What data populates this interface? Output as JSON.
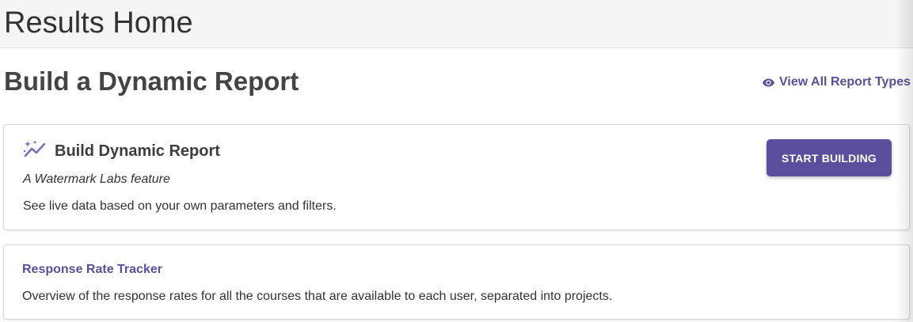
{
  "header": {
    "title": "Results Home"
  },
  "main": {
    "heading": "Build a Dynamic Report",
    "view_all_link": {
      "label": "View All Report Types",
      "icon": "eye-icon"
    },
    "dynamic_card": {
      "icon": "sparkle-trend-icon",
      "title": "Build Dynamic Report",
      "subtitle": "A Watermark Labs feature",
      "description": "See live data based on your own parameters and filters.",
      "button_label": "START BUILDING"
    },
    "response_card": {
      "title": "Response Rate Tracker",
      "description": "Overview of the response rates for all the courses that are available to each user, separated into projects."
    }
  },
  "colors": {
    "accent": "#5b4e9c",
    "header_bg": "#f5f5f5",
    "text": "#333333"
  }
}
